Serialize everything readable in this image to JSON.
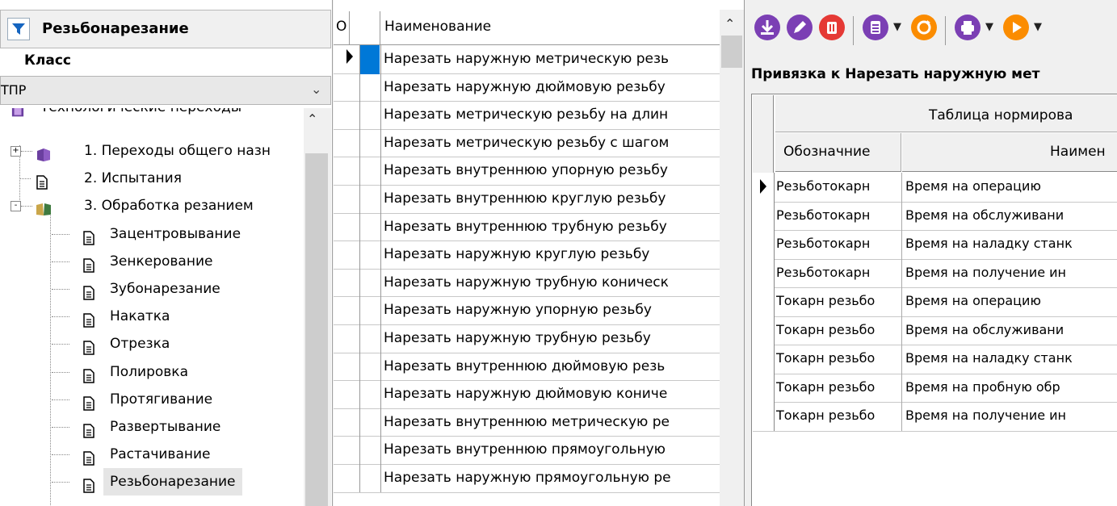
{
  "left_panel": {
    "title": "Резьбонарезание",
    "class_label": "Класс",
    "class_value": "ТПР",
    "tree_partial_label": "Технологические переходы",
    "tree": [
      {
        "label": "1. Переходы общего назн",
        "icon": "book-icon",
        "expander": "+"
      },
      {
        "label": "2. Испытания",
        "icon": "document-icon"
      },
      {
        "label": "3. Обработка резанием",
        "icon": "open-book-icon",
        "expander": "-"
      },
      {
        "label": "Зацентровывание",
        "icon": "document-icon"
      },
      {
        "label": "Зенкерование",
        "icon": "document-icon"
      },
      {
        "label": "Зубонарезание",
        "icon": "document-icon"
      },
      {
        "label": "Накатка",
        "icon": "document-icon"
      },
      {
        "label": "Отрезка",
        "icon": "document-icon"
      },
      {
        "label": "Полировка",
        "icon": "document-icon"
      },
      {
        "label": "Протягивание",
        "icon": "document-icon"
      },
      {
        "label": "Развертывание",
        "icon": "document-icon"
      },
      {
        "label": "Растачивание",
        "icon": "document-icon"
      },
      {
        "label": "Резьбонарезание",
        "icon": "document-icon",
        "selected": true
      }
    ]
  },
  "middle_panel": {
    "col_o": "О",
    "col_name": "Наименование",
    "rows": [
      "Нарезать наружную метрическую резь",
      "Нарезать наружную дюймовую резьбу",
      " Нарезать метрическую резьбу на длин",
      " Нарезать метрическую резьбу с шагом",
      "Нарезать внутреннюю упорную резьбу",
      "Нарезать внутреннюю круглую резьбу",
      "Нарезать внутреннюю трубную резьбу",
      "Нарезать наружную круглую резьбу",
      "Нарезать наружную трубную коническ",
      "Нарезать наружную упорную резьбу",
      "Нарезать наружную трубную резьбу",
      "Нарезать внутреннюю дюймовую резь",
      "Нарезать наружную дюймовую коничe",
      "Нарезать внутреннюю метрическую ре",
      "Нарезать внутреннюю прямоугольную",
      "Нарезать наружную прямоугольную ре"
    ]
  },
  "right_panel": {
    "toolbar": [
      {
        "name": "download-icon",
        "color": "#7b3fb4"
      },
      {
        "name": "edit-icon",
        "color": "#7b3fb4"
      },
      {
        "name": "delete-icon",
        "color": "#e53935"
      },
      {
        "name": "list-icon",
        "color": "#7b3fb4"
      },
      {
        "name": "refresh-icon",
        "color": "#fb8c00"
      },
      {
        "name": "print-icon",
        "color": "#7b3fb4"
      },
      {
        "name": "play-icon",
        "color": "#fb8c00"
      }
    ],
    "binding_title": "Привязка к Нарезать наружную мет",
    "band_header": "Таблица нормирова",
    "col_code": "Обозначние",
    "col_name": "Наимен",
    "rows": [
      {
        "code": "Резьботокарн",
        "name": "Время на операцию"
      },
      {
        "code": "Резьботокарн",
        "name": "Время на обслуживани"
      },
      {
        "code": "Резьботокарн",
        "name": "Время на наладку станк"
      },
      {
        "code": "Резьботокарн",
        "name": "Время на получение ин"
      },
      {
        "code": "Токарн резьбо",
        "name": "Время на операцию"
      },
      {
        "code": "Токарн резьбо",
        "name": "Время на обслуживани"
      },
      {
        "code": "Токарн резьбо",
        "name": "Время на наладку станк"
      },
      {
        "code": "Токарн резьбо",
        "name": "Время на пробную обр"
      },
      {
        "code": "Токарн резьбо",
        "name": "Время на получение ин"
      }
    ]
  }
}
